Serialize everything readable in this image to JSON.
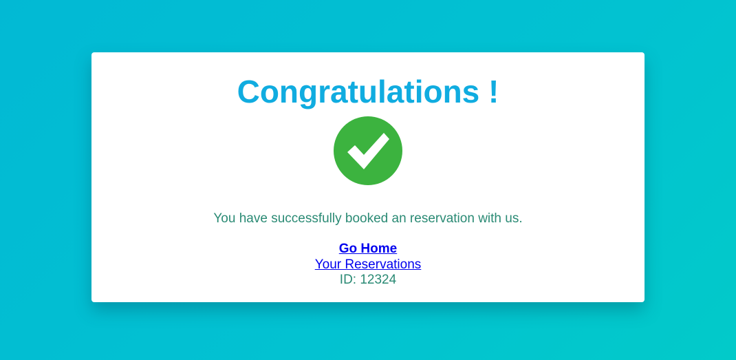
{
  "card": {
    "title": "Congratulations !",
    "message": "You have successfully booked an reservation with us.",
    "go_home_label": "Go Home",
    "reservations_label": "Your Reservations",
    "reservation_id": "ID: 12324",
    "icon": "check-circle-icon"
  },
  "colors": {
    "title": "#10ace0",
    "success": "#3cb33f",
    "text": "#2a8a74",
    "link": "#0000ee",
    "background": "#02c2d1"
  }
}
